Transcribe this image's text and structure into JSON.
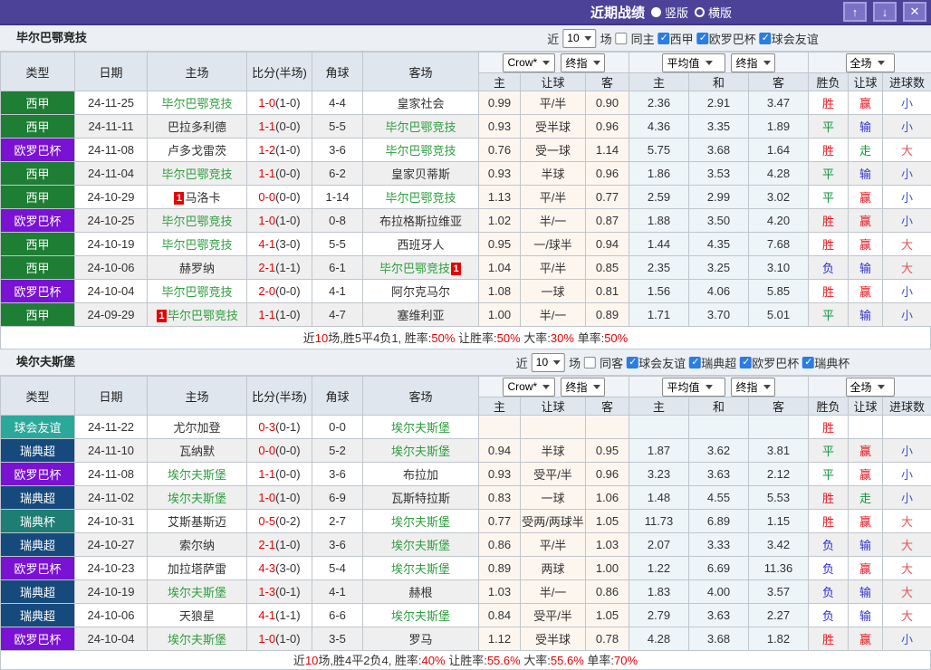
{
  "titlebar": {
    "title": "近期战绩",
    "layout_vertical": "竖版",
    "layout_horizontal": "横版",
    "up_button": "↑",
    "down_button": "↓",
    "close_button": "✕"
  },
  "filter_labels": {
    "near": "近",
    "matches": "场"
  },
  "columns": {
    "type": "类型",
    "date": "日期",
    "home": "主场",
    "score": "比分(半场)",
    "corner": "角球",
    "away": "客场",
    "odds_home": "主",
    "odds_handicap": "让球",
    "odds_away": "客",
    "avg_home": "主",
    "avg_draw": "和",
    "avg_away": "客",
    "result_wdl": "胜负",
    "result_handicap": "让球",
    "result_goals": "进球数",
    "dd_crow": "Crow*",
    "dd_final1": "终指",
    "dd_avg": "平均值",
    "dd_final2": "终指",
    "dd_scope": "全场"
  },
  "league_colors": {
    "西甲": "#1e7e34",
    "欧罗巴杯": "#7a12d4",
    "球会友谊": "#2aa99b",
    "瑞典超": "#164a7d",
    "瑞典杯": "#1f7e74"
  },
  "result_colors": {
    "胜": "#e8131d",
    "平": "#12953c",
    "负": "#2b2bd5",
    "赢": "#e8131d",
    "输": "#3333cc",
    "走": "#12953c",
    "大": "#e25555",
    "小": "#3f51c9"
  },
  "colors": {
    "accent_bar": "#4c4399",
    "score_red": "#e60000",
    "team_green": "#2f9e3f"
  },
  "sections": [
    {
      "team": "毕尔巴鄂竞技",
      "filter": {
        "count": "10",
        "same_label": "同主",
        "same_checked": false,
        "leagues": [
          {
            "label": "西甲",
            "checked": true
          },
          {
            "label": "欧罗巴杯",
            "checked": true
          },
          {
            "label": "球会友谊",
            "checked": true
          }
        ]
      },
      "rows": [
        {
          "league": "西甲",
          "date": "24-11-25",
          "home": "毕尔巴鄂竞技",
          "home_green": true,
          "home_badge": null,
          "score": "1-0",
          "half": "(1-0)",
          "corner": "4-4",
          "away": "皇家社会",
          "away_green": false,
          "away_badge": null,
          "odds": [
            "0.99",
            "平/半",
            "0.90"
          ],
          "avg": [
            "2.36",
            "2.91",
            "3.47"
          ],
          "results": [
            "胜",
            "赢",
            "小"
          ]
        },
        {
          "league": "西甲",
          "date": "24-11-11",
          "home": "巴拉多利德",
          "home_green": false,
          "home_badge": null,
          "score": "1-1",
          "half": "(0-0)",
          "corner": "5-5",
          "away": "毕尔巴鄂竞技",
          "away_green": true,
          "away_badge": null,
          "odds": [
            "0.93",
            "受半球",
            "0.96"
          ],
          "avg": [
            "4.36",
            "3.35",
            "1.89"
          ],
          "results": [
            "平",
            "输",
            "小"
          ]
        },
        {
          "league": "欧罗巴杯",
          "date": "24-11-08",
          "home": "卢多戈雷茨",
          "home_green": false,
          "home_badge": null,
          "score": "1-2",
          "half": "(1-0)",
          "corner": "3-6",
          "away": "毕尔巴鄂竞技",
          "away_green": true,
          "away_badge": null,
          "odds": [
            "0.76",
            "受一球",
            "1.14"
          ],
          "avg": [
            "5.75",
            "3.68",
            "1.64"
          ],
          "results": [
            "胜",
            "走",
            "大"
          ]
        },
        {
          "league": "西甲",
          "date": "24-11-04",
          "home": "毕尔巴鄂竞技",
          "home_green": true,
          "home_badge": null,
          "score": "1-1",
          "half": "(0-0)",
          "corner": "6-2",
          "away": "皇家贝蒂斯",
          "away_green": false,
          "away_badge": null,
          "odds": [
            "0.93",
            "半球",
            "0.96"
          ],
          "avg": [
            "1.86",
            "3.53",
            "4.28"
          ],
          "results": [
            "平",
            "输",
            "小"
          ]
        },
        {
          "league": "西甲",
          "date": "24-10-29",
          "home": "马洛卡",
          "home_green": false,
          "home_badge": {
            "text": "1",
            "pos": "pre"
          },
          "score": "0-0",
          "half": "(0-0)",
          "corner": "1-14",
          "away": "毕尔巴鄂竞技",
          "away_green": true,
          "away_badge": null,
          "odds": [
            "1.13",
            "平/半",
            "0.77"
          ],
          "avg": [
            "2.59",
            "2.99",
            "3.02"
          ],
          "results": [
            "平",
            "赢",
            "小"
          ]
        },
        {
          "league": "欧罗巴杯",
          "date": "24-10-25",
          "home": "毕尔巴鄂竞技",
          "home_green": true,
          "home_badge": null,
          "score": "1-0",
          "half": "(1-0)",
          "corner": "0-8",
          "away": "布拉格斯拉维亚",
          "away_green": false,
          "away_badge": null,
          "odds": [
            "1.02",
            "半/一",
            "0.87"
          ],
          "avg": [
            "1.88",
            "3.50",
            "4.20"
          ],
          "results": [
            "胜",
            "赢",
            "小"
          ]
        },
        {
          "league": "西甲",
          "date": "24-10-19",
          "home": "毕尔巴鄂竞技",
          "home_green": true,
          "home_badge": null,
          "score": "4-1",
          "half": "(3-0)",
          "corner": "5-5",
          "away": "西班牙人",
          "away_green": false,
          "away_badge": null,
          "odds": [
            "0.95",
            "一/球半",
            "0.94"
          ],
          "avg": [
            "1.44",
            "4.35",
            "7.68"
          ],
          "results": [
            "胜",
            "赢",
            "大"
          ]
        },
        {
          "league": "西甲",
          "date": "24-10-06",
          "home": "赫罗纳",
          "home_green": false,
          "home_badge": null,
          "score": "2-1",
          "half": "(1-1)",
          "corner": "6-1",
          "away": "毕尔巴鄂竞技",
          "away_green": true,
          "away_badge": {
            "text": "1",
            "pos": "post"
          },
          "odds": [
            "1.04",
            "平/半",
            "0.85"
          ],
          "avg": [
            "2.35",
            "3.25",
            "3.10"
          ],
          "results": [
            "负",
            "输",
            "大"
          ]
        },
        {
          "league": "欧罗巴杯",
          "date": "24-10-04",
          "home": "毕尔巴鄂竞技",
          "home_green": true,
          "home_badge": null,
          "score": "2-0",
          "half": "(0-0)",
          "corner": "4-1",
          "away": "阿尔克马尔",
          "away_green": false,
          "away_badge": null,
          "odds": [
            "1.08",
            "一球",
            "0.81"
          ],
          "avg": [
            "1.56",
            "4.06",
            "5.85"
          ],
          "results": [
            "胜",
            "赢",
            "小"
          ]
        },
        {
          "league": "西甲",
          "date": "24-09-29",
          "home": "毕尔巴鄂竞技",
          "home_green": true,
          "home_badge": {
            "text": "1",
            "pos": "pre"
          },
          "score": "1-1",
          "half": "(1-0)",
          "corner": "4-7",
          "away": "塞维利亚",
          "away_green": false,
          "away_badge": null,
          "odds": [
            "1.00",
            "半/一",
            "0.89"
          ],
          "avg": [
            "1.71",
            "3.70",
            "5.01"
          ],
          "results": [
            "平",
            "输",
            "小"
          ]
        }
      ],
      "summary": [
        {
          "t": "近"
        },
        {
          "t": "10",
          "red": true
        },
        {
          "t": "场,胜5平4负1, 胜率:"
        },
        {
          "t": "50%",
          "red": true
        },
        {
          "t": " 让胜率:"
        },
        {
          "t": "50%",
          "red": true
        },
        {
          "t": " 大率:"
        },
        {
          "t": "30%",
          "red": true
        },
        {
          "t": " 单率:"
        },
        {
          "t": "50%",
          "red": true
        }
      ]
    },
    {
      "team": "埃尔夫斯堡",
      "filter": {
        "count": "10",
        "same_label": "同客",
        "same_checked": false,
        "leagues": [
          {
            "label": "球会友谊",
            "checked": true
          },
          {
            "label": "瑞典超",
            "checked": true
          },
          {
            "label": "欧罗巴杯",
            "checked": true
          },
          {
            "label": "瑞典杯",
            "checked": true
          }
        ]
      },
      "rows": [
        {
          "league": "球会友谊",
          "date": "24-11-22",
          "home": "尤尔加登",
          "home_green": false,
          "home_badge": null,
          "score": "0-3",
          "half": "(0-1)",
          "corner": "0-0",
          "away": "埃尔夫斯堡",
          "away_green": true,
          "away_badge": null,
          "odds": [
            "",
            "",
            ""
          ],
          "avg": [
            "",
            "",
            ""
          ],
          "results": [
            "胜",
            "",
            ""
          ]
        },
        {
          "league": "瑞典超",
          "date": "24-11-10",
          "home": "瓦纳默",
          "home_green": false,
          "home_badge": null,
          "score": "0-0",
          "half": "(0-0)",
          "corner": "5-2",
          "away": "埃尔夫斯堡",
          "away_green": true,
          "away_badge": null,
          "odds": [
            "0.94",
            "半球",
            "0.95"
          ],
          "avg": [
            "1.87",
            "3.62",
            "3.81"
          ],
          "results": [
            "平",
            "赢",
            "小"
          ]
        },
        {
          "league": "欧罗巴杯",
          "date": "24-11-08",
          "home": "埃尔夫斯堡",
          "home_green": true,
          "home_badge": null,
          "score": "1-1",
          "half": "(0-0)",
          "corner": "3-6",
          "away": "布拉加",
          "away_green": false,
          "away_badge": null,
          "odds": [
            "0.93",
            "受平/半",
            "0.96"
          ],
          "avg": [
            "3.23",
            "3.63",
            "2.12"
          ],
          "results": [
            "平",
            "赢",
            "小"
          ]
        },
        {
          "league": "瑞典超",
          "date": "24-11-02",
          "home": "埃尔夫斯堡",
          "home_green": true,
          "home_badge": null,
          "score": "1-0",
          "half": "(1-0)",
          "corner": "6-9",
          "away": "瓦斯特拉斯",
          "away_green": false,
          "away_badge": null,
          "odds": [
            "0.83",
            "一球",
            "1.06"
          ],
          "avg": [
            "1.48",
            "4.55",
            "5.53"
          ],
          "results": [
            "胜",
            "走",
            "小"
          ]
        },
        {
          "league": "瑞典杯",
          "date": "24-10-31",
          "home": "艾斯基斯迈",
          "home_green": false,
          "home_badge": null,
          "score": "0-5",
          "half": "(0-2)",
          "corner": "2-7",
          "away": "埃尔夫斯堡",
          "away_green": true,
          "away_badge": null,
          "odds": [
            "0.77",
            "受两/两球半",
            "1.05"
          ],
          "avg": [
            "11.73",
            "6.89",
            "1.15"
          ],
          "results": [
            "胜",
            "赢",
            "大"
          ]
        },
        {
          "league": "瑞典超",
          "date": "24-10-27",
          "home": "索尔纳",
          "home_green": false,
          "home_badge": null,
          "score": "2-1",
          "half": "(1-0)",
          "corner": "3-6",
          "away": "埃尔夫斯堡",
          "away_green": true,
          "away_badge": null,
          "odds": [
            "0.86",
            "平/半",
            "1.03"
          ],
          "avg": [
            "2.07",
            "3.33",
            "3.42"
          ],
          "results": [
            "负",
            "输",
            "大"
          ]
        },
        {
          "league": "欧罗巴杯",
          "date": "24-10-23",
          "home": "加拉塔萨雷",
          "home_green": false,
          "home_badge": null,
          "score": "4-3",
          "half": "(3-0)",
          "corner": "5-4",
          "away": "埃尔夫斯堡",
          "away_green": true,
          "away_badge": null,
          "odds": [
            "0.89",
            "两球",
            "1.00"
          ],
          "avg": [
            "1.22",
            "6.69",
            "11.36"
          ],
          "results": [
            "负",
            "赢",
            "大"
          ]
        },
        {
          "league": "瑞典超",
          "date": "24-10-19",
          "home": "埃尔夫斯堡",
          "home_green": true,
          "home_badge": null,
          "score": "1-3",
          "half": "(0-1)",
          "corner": "4-1",
          "away": "赫根",
          "away_green": false,
          "away_badge": null,
          "odds": [
            "1.03",
            "半/一",
            "0.86"
          ],
          "avg": [
            "1.83",
            "4.00",
            "3.57"
          ],
          "results": [
            "负",
            "输",
            "大"
          ]
        },
        {
          "league": "瑞典超",
          "date": "24-10-06",
          "home": "天狼星",
          "home_green": false,
          "home_badge": null,
          "score": "4-1",
          "half": "(1-1)",
          "corner": "6-6",
          "away": "埃尔夫斯堡",
          "away_green": true,
          "away_badge": null,
          "odds": [
            "0.84",
            "受平/半",
            "1.05"
          ],
          "avg": [
            "2.79",
            "3.63",
            "2.27"
          ],
          "results": [
            "负",
            "输",
            "大"
          ]
        },
        {
          "league": "欧罗巴杯",
          "date": "24-10-04",
          "home": "埃尔夫斯堡",
          "home_green": true,
          "home_badge": null,
          "score": "1-0",
          "half": "(1-0)",
          "corner": "3-5",
          "away": "罗马",
          "away_green": false,
          "away_badge": null,
          "odds": [
            "1.12",
            "受半球",
            "0.78"
          ],
          "avg": [
            "4.28",
            "3.68",
            "1.82"
          ],
          "results": [
            "胜",
            "赢",
            "小"
          ]
        }
      ],
      "summary": [
        {
          "t": "近"
        },
        {
          "t": "10",
          "red": true
        },
        {
          "t": "场,胜4平2负4, 胜率:"
        },
        {
          "t": "40%",
          "red": true
        },
        {
          "t": " 让胜率:"
        },
        {
          "t": "55.6%",
          "red": true
        },
        {
          "t": " 大率:"
        },
        {
          "t": "55.6%",
          "red": true
        },
        {
          "t": " 单率:"
        },
        {
          "t": "70%",
          "red": true
        }
      ]
    }
  ]
}
